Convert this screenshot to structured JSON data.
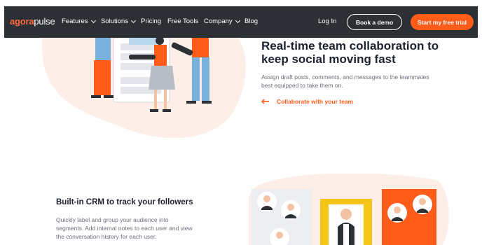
{
  "nav": {
    "logo_part1": "agora",
    "logo_part2": "pulse",
    "items": [
      {
        "label": "Features",
        "dropdown": true
      },
      {
        "label": "Solutions",
        "dropdown": true
      },
      {
        "label": "Pricing",
        "dropdown": false
      },
      {
        "label": "Free Tools",
        "dropdown": false
      },
      {
        "label": "Company",
        "dropdown": true
      },
      {
        "label": "Blog",
        "dropdown": false
      }
    ],
    "login": "Log In",
    "demo": "Book a demo",
    "trial": "Start my free trial"
  },
  "hero": {
    "title": "Real-time team collaboration to keep social moving fast",
    "description": "Assign draft posts, comments, and messages to the teammates best equipped to take them on.",
    "link": "Collaborate with your team"
  },
  "crm": {
    "title": "Built-in CRM to track your followers",
    "description": "Quickly label and group your audience into segments. Add internal notes to each user and view the conversation history for each user."
  },
  "colors": {
    "nav_bg": "#2c2f33",
    "accent": "#ff5c1a",
    "blob": "#fdeee8",
    "yellow": "#f5c518"
  },
  "icons": [
    "chevron-down-icon",
    "arrow-left-icon"
  ]
}
